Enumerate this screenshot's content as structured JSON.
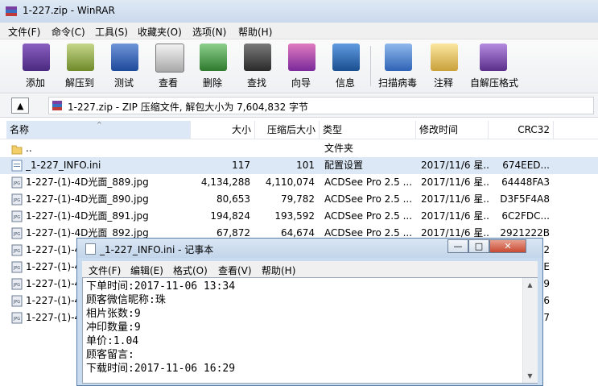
{
  "window": {
    "title": "1-227.zip - WinRAR"
  },
  "menu": [
    "文件(F)",
    "命令(C)",
    "工具(S)",
    "收藏夹(O)",
    "选项(N)",
    "帮助(H)"
  ],
  "toolbar": [
    {
      "label": "添加",
      "icon": "add-archive-icon",
      "color": "#6a3fa0"
    },
    {
      "label": "解压到",
      "icon": "extract-to-icon",
      "color": "#7a9a2a"
    },
    {
      "label": "测试",
      "icon": "test-icon",
      "color": "#2a5bb5"
    },
    {
      "label": "查看",
      "icon": "view-icon",
      "color": "#888888"
    },
    {
      "label": "删除",
      "icon": "delete-icon",
      "color": "#3a8a3a"
    },
    {
      "label": "查找",
      "icon": "find-icon",
      "color": "#444444"
    },
    {
      "label": "向导",
      "icon": "wizard-icon",
      "color": "#b03a8a"
    },
    {
      "label": "信息",
      "icon": "info-icon",
      "color": "#1f5fa8"
    },
    {
      "label": "扫描病毒",
      "icon": "scan-virus-icon",
      "color": "#3a6fc0"
    },
    {
      "label": "注释",
      "icon": "comment-icon",
      "color": "#c9a13a"
    },
    {
      "label": "自解压格式",
      "icon": "sfx-icon",
      "color": "#7a4aa0"
    }
  ],
  "address": {
    "text": "1-227.zip - ZIP 压缩文件, 解包大小为 7,604,832 字节"
  },
  "columns": [
    "名称",
    "大小",
    "压缩后大小",
    "类型",
    "修改时间",
    "CRC32"
  ],
  "files": [
    {
      "name": "..",
      "size": "",
      "packed": "",
      "type": "文件夹",
      "modified": "",
      "crc": "",
      "kind": "folder"
    },
    {
      "name": "_1-227_INFO.ini",
      "size": "117",
      "packed": "101",
      "type": "配置设置",
      "modified": "2017/11/6 星...",
      "crc": "674EED...",
      "kind": "ini"
    },
    {
      "name": "1-227-(1)-4D光面_889.jpg",
      "size": "4,134,288",
      "packed": "4,110,074",
      "type": "ACDSee Pro 2.5 ...",
      "modified": "2017/11/6 星...",
      "crc": "64448FA3",
      "kind": "jpg"
    },
    {
      "name": "1-227-(1)-4D光面_890.jpg",
      "size": "80,653",
      "packed": "79,782",
      "type": "ACDSee Pro 2.5 ...",
      "modified": "2017/11/6 星...",
      "crc": "D3F5F4A8",
      "kind": "jpg"
    },
    {
      "name": "1-227-(1)-4D光面_891.jpg",
      "size": "194,824",
      "packed": "193,592",
      "type": "ACDSee Pro 2.5 ...",
      "modified": "2017/11/6 星...",
      "crc": "6C2FDC...",
      "kind": "jpg"
    },
    {
      "name": "1-227-(1)-4D光面_892.jpg",
      "size": "67,872",
      "packed": "64,674",
      "type": "ACDSee Pro 2.5 ...",
      "modified": "2017/11/6 星...",
      "crc": "2921222B",
      "kind": "jpg"
    },
    {
      "name": "1-227-(1)-4D",
      "size": "",
      "packed": "",
      "type": "",
      "modified": "",
      "crc": "5D2",
      "kind": "jpg"
    },
    {
      "name": "1-227-(1)-4D",
      "size": "",
      "packed": "",
      "type": "",
      "modified": "",
      "crc": "BE",
      "kind": "jpg"
    },
    {
      "name": "1-227-(1)-4D",
      "size": "",
      "packed": "",
      "type": "",
      "modified": "",
      "crc": "E39",
      "kind": "jpg"
    },
    {
      "name": "1-227-(1)-4D",
      "size": "",
      "packed": "",
      "type": "",
      "modified": "",
      "crc": "3A6",
      "kind": "jpg"
    },
    {
      "name": "1-227-(1)-4D",
      "size": "",
      "packed": "",
      "type": "",
      "modified": "",
      "crc": "397",
      "kind": "jpg"
    }
  ],
  "notepad": {
    "title": "_1-227_INFO.ini - 记事本",
    "menu": [
      "文件(F)",
      "编辑(E)",
      "格式(O)",
      "查看(V)",
      "帮助(H)"
    ],
    "lines": [
      "下单时间:2017-11-06 13:34",
      "顾客微信昵称:珠",
      "相片张数:9",
      "冲印数量:9",
      "单价:1.04",
      "顾客留言:",
      "下载时间:2017-11-06 16:29"
    ]
  }
}
